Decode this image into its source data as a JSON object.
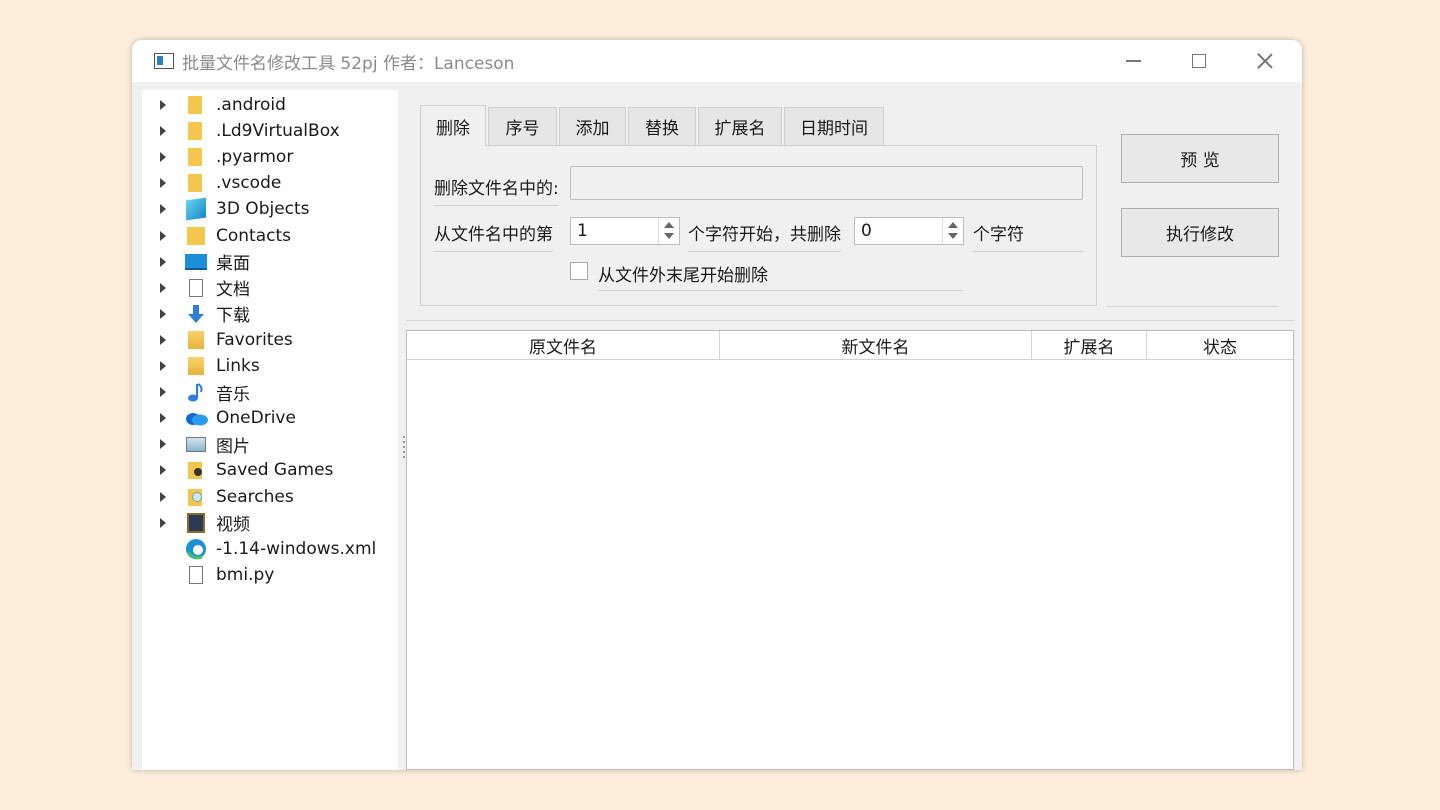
{
  "window": {
    "title": "批量文件名修改工具   52pj  作者：Lanceson"
  },
  "tree": {
    "items": [
      {
        "label": ".android",
        "icon": "folder-icon",
        "expandable": true
      },
      {
        "label": ".Ld9VirtualBox",
        "icon": "folder-icon",
        "expandable": true
      },
      {
        "label": ".pyarmor",
        "icon": "folder-icon",
        "expandable": true
      },
      {
        "label": ".vscode",
        "icon": "folder-icon",
        "expandable": true
      },
      {
        "label": "3D Objects",
        "icon": "3d-objects-icon",
        "expandable": true
      },
      {
        "label": "Contacts",
        "icon": "contacts-icon",
        "expandable": true
      },
      {
        "label": "桌面",
        "icon": "desktop-icon",
        "expandable": true
      },
      {
        "label": "文档",
        "icon": "documents-icon",
        "expandable": true
      },
      {
        "label": "下载",
        "icon": "downloads-icon",
        "expandable": true
      },
      {
        "label": "Favorites",
        "icon": "favorites-icon",
        "expandable": true
      },
      {
        "label": "Links",
        "icon": "links-icon",
        "expandable": true
      },
      {
        "label": "音乐",
        "icon": "music-icon",
        "expandable": true
      },
      {
        "label": "OneDrive",
        "icon": "onedrive-icon",
        "expandable": true
      },
      {
        "label": "图片",
        "icon": "pictures-icon",
        "expandable": true
      },
      {
        "label": "Saved Games",
        "icon": "saved-games-icon",
        "expandable": true
      },
      {
        "label": "Searches",
        "icon": "searches-icon",
        "expandable": true
      },
      {
        "label": "视频",
        "icon": "videos-icon",
        "expandable": true
      },
      {
        "label": "-1.14-windows.xml",
        "icon": "edge-file-icon",
        "expandable": false
      },
      {
        "label": "bmi.py",
        "icon": "python-file-icon",
        "expandable": false
      }
    ]
  },
  "tabs": [
    {
      "label": "删除",
      "active": true
    },
    {
      "label": "序号",
      "active": false
    },
    {
      "label": "添加",
      "active": false
    },
    {
      "label": "替换",
      "active": false
    },
    {
      "label": "扩展名",
      "active": false
    },
    {
      "label": "日期时间",
      "active": false
    }
  ],
  "delete_panel": {
    "delete_in_name_label": "删除文件名中的:",
    "delete_in_name_value": "",
    "from_position_label": "从文件名中的第",
    "start_value": "1",
    "start_suffix_label": "个字符开始，共删除",
    "count_value": "0",
    "count_suffix_label": "个字符",
    "from_end_label": "从文件外末尾开始删除",
    "from_end_checked": false
  },
  "buttons": {
    "preview": "预 览",
    "execute": "执行修改"
  },
  "table": {
    "columns": [
      "原文件名",
      "新文件名",
      "扩展名",
      "状态"
    ],
    "rows": []
  }
}
